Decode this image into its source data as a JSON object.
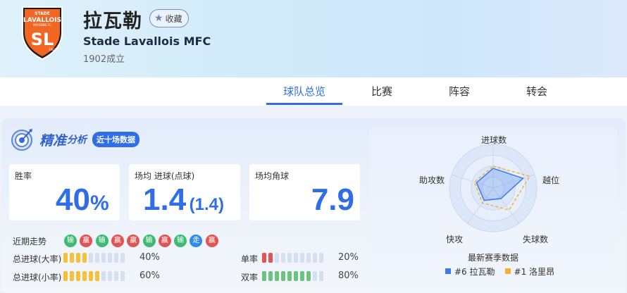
{
  "team": {
    "name": "拉瓦勒",
    "fav_label": "收藏",
    "english_name": "Stade Lavallois MFC",
    "founded": "1902成立",
    "logo": {
      "top_text": "STADE",
      "main_text": "LAVALLOIS",
      "sub_text": "MAYENNE FC",
      "letters": "SL",
      "year": "1902"
    }
  },
  "tabs": [
    {
      "label": "球队总览",
      "active": true
    },
    {
      "label": "比赛",
      "active": false
    },
    {
      "label": "阵容",
      "active": false
    },
    {
      "label": "转会",
      "active": false
    }
  ],
  "analysis": {
    "title_main": "精准",
    "title_sub": "分析",
    "badge": "近十场数据",
    "win_rate": {
      "label": "胜率",
      "value": "40",
      "unit": "%"
    },
    "avg_goals": {
      "label": "场均 进球(点球)",
      "value": "1.4",
      "sub": "(1.4)"
    },
    "avg_corners": {
      "label": "场均角球",
      "value": "7.9"
    },
    "trend": {
      "label": "近期走势",
      "results": [
        {
          "text": "输",
          "type": "loss"
        },
        {
          "text": "赢",
          "type": "win"
        },
        {
          "text": "输",
          "type": "loss"
        },
        {
          "text": "赢",
          "type": "win"
        },
        {
          "text": "赢",
          "type": "win"
        },
        {
          "text": "输",
          "type": "loss"
        },
        {
          "text": "赢",
          "type": "win"
        },
        {
          "text": "输",
          "type": "loss"
        },
        {
          "text": "走",
          "type": "draw"
        },
        {
          "text": "赢",
          "type": "win"
        }
      ]
    },
    "bars": [
      {
        "label": "总进球(大率)",
        "value_text": "40%",
        "filled": 4,
        "total": 10,
        "color": "#f5c03a"
      },
      {
        "label": "总进球(小率)",
        "value_text": "60%",
        "filled": 6,
        "total": 10,
        "color": "#f5c03a"
      },
      {
        "label": "单率",
        "value_text": "20%",
        "filled": 2,
        "total": 10,
        "color": "#e25454"
      },
      {
        "label": "双率",
        "value_text": "80%",
        "filled": 8,
        "total": 10,
        "color": "#6cc57f"
      }
    ]
  },
  "radar": {
    "axes": [
      "进球数",
      "越位",
      "失球数",
      "快攻",
      "助攻数"
    ],
    "caption": "最新赛季数据",
    "series": [
      {
        "name": "#6 拉瓦勒",
        "color": "#3b7be8",
        "values": [
          0.45,
          0.72,
          0.3,
          0.35,
          0.4
        ]
      },
      {
        "name": "#1 洛里昂",
        "color": "#f5b22a",
        "values": [
          0.5,
          0.88,
          0.62,
          0.42,
          0.45
        ]
      }
    ]
  },
  "colors": {
    "accent": "#2f6ee8",
    "win": "#e25454",
    "loss": "#3dbb72",
    "draw": "#2f8ce8"
  }
}
